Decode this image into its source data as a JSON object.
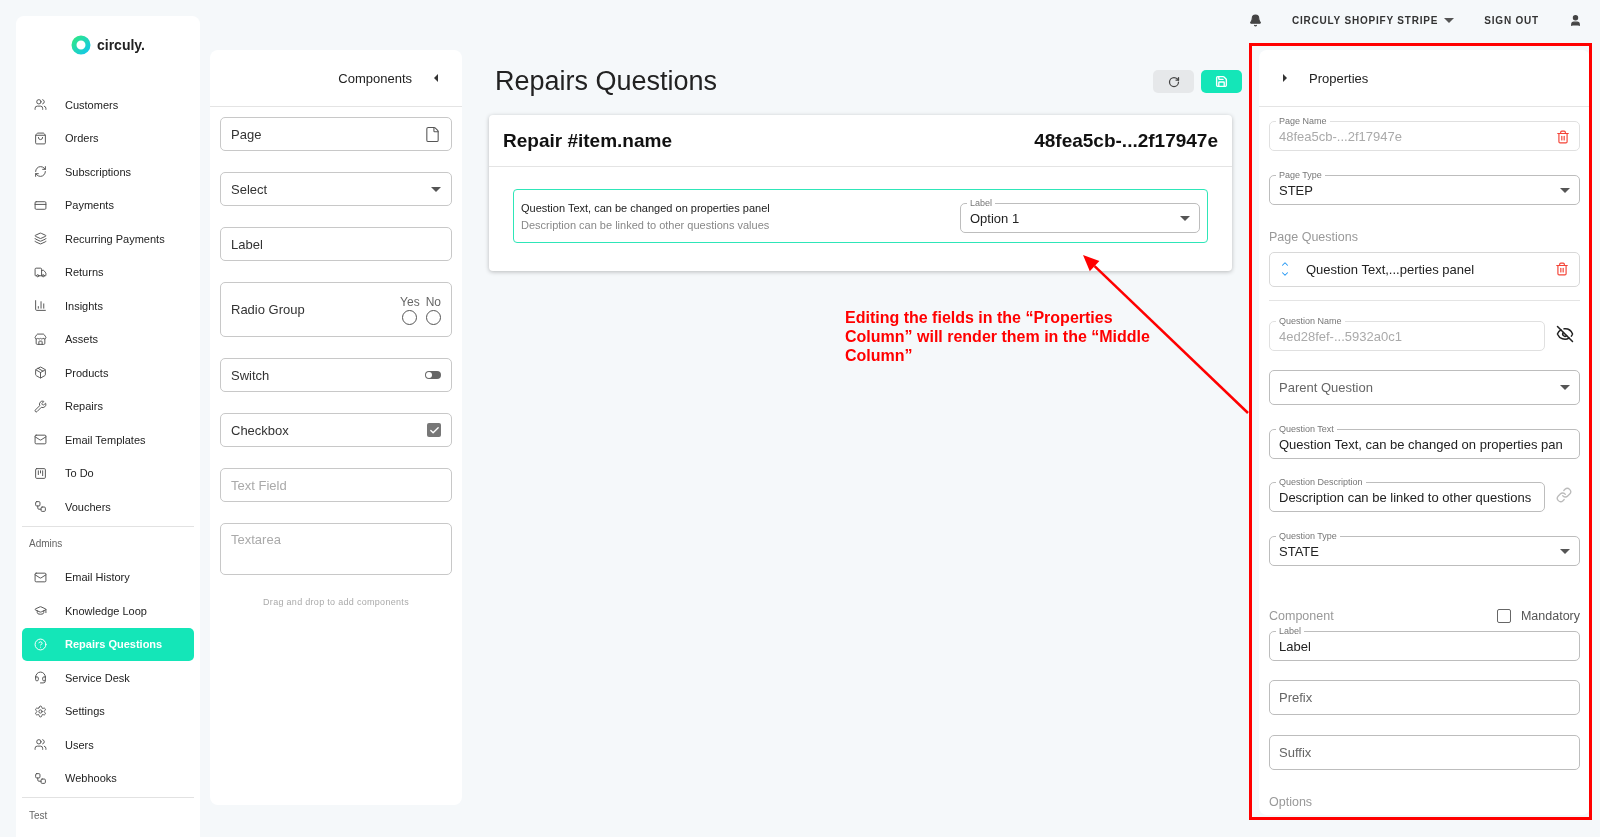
{
  "sidebar": {
    "logo": "circuly.",
    "groups": [
      {
        "items": [
          {
            "label": "Customers",
            "selected": false
          },
          {
            "label": "Orders",
            "selected": false
          },
          {
            "label": "Subscriptions",
            "selected": false
          },
          {
            "label": "Payments",
            "selected": false
          },
          {
            "label": "Recurring Payments",
            "selected": false
          },
          {
            "label": "Returns",
            "selected": false
          },
          {
            "label": "Insights",
            "selected": false
          },
          {
            "label": "Assets",
            "selected": false
          },
          {
            "label": "Products",
            "selected": false
          },
          {
            "label": "Repairs",
            "selected": false
          },
          {
            "label": "Email Templates",
            "selected": false
          },
          {
            "label": "To Do",
            "selected": false
          },
          {
            "label": "Vouchers",
            "selected": false
          }
        ]
      },
      {
        "heading": "Admins",
        "items": [
          {
            "label": "Email History",
            "selected": false
          },
          {
            "label": "Knowledge Loop",
            "selected": false
          },
          {
            "label": "Repairs Questions",
            "selected": true
          },
          {
            "label": "Service Desk",
            "selected": false
          },
          {
            "label": "Settings",
            "selected": false
          },
          {
            "label": "Users",
            "selected": false
          },
          {
            "label": "Webhooks",
            "selected": false
          }
        ]
      },
      {
        "heading": "Test"
      }
    ]
  },
  "top_bar": {
    "account": "CIRCULY SHOPIFY STRIPE",
    "sign_out": "SIGN OUT"
  },
  "components": {
    "title": "Components",
    "items": [
      {
        "kind": "page",
        "label": "Page"
      },
      {
        "kind": "select",
        "label": "Select"
      },
      {
        "kind": "label",
        "label": "Label"
      },
      {
        "kind": "radio",
        "label": "Radio Group",
        "options": [
          "Yes",
          "No"
        ]
      },
      {
        "kind": "switch",
        "label": "Switch",
        "on": false
      },
      {
        "kind": "checkbox",
        "label": "Checkbox",
        "checked": true
      },
      {
        "kind": "textfield",
        "placeholder": "Text Field"
      },
      {
        "kind": "textarea",
        "placeholder": "Textarea"
      }
    ],
    "hint": "Drag and drop to add components"
  },
  "main": {
    "title": "Repairs Questions",
    "card": {
      "title": "Repair #item.name",
      "id": "48fea5cb-...2f17947e",
      "question": {
        "text": "Question Text, can be changed on properties panel",
        "description": "Description can be linked to other questions values",
        "select": {
          "label": "Label",
          "value": "Option 1"
        }
      }
    },
    "annotation": "Editing the fields in the “Properties Column” will render them in the “Middle Column”"
  },
  "properties": {
    "title": "Properties",
    "items": [
      {
        "kind": "delete_field",
        "label": "Page Name",
        "value": "48fea5cb-...2f17947e",
        "disabled": true
      },
      {
        "kind": "select",
        "label": "Page Type",
        "value": "STEP"
      },
      {
        "kind": "section",
        "title": "Page Questions"
      },
      {
        "kind": "reorder_item",
        "value": "Question Text,...perties panel"
      },
      {
        "kind": "hide_field",
        "label": "Question Name",
        "value": "4ed28fef-...5932a0c1",
        "disabled": true
      },
      {
        "kind": "select",
        "placeholder": "Parent Question"
      },
      {
        "kind": "field",
        "label": "Question Text",
        "value": "Question Text, can be changed on properties pan",
        "disabled": false
      },
      {
        "kind": "link_field",
        "label": "Question Description",
        "value": "Description can be linked to other questions",
        "disabled": false
      },
      {
        "kind": "select",
        "label": "Question Type",
        "value": "STATE"
      },
      {
        "kind": "component_header",
        "title": "Component",
        "checkbox": {
          "label": "Mandatory",
          "checked": false
        }
      },
      {
        "kind": "field",
        "label": "Label",
        "value": "Label",
        "disabled": false
      },
      {
        "kind": "field",
        "placeholder": "Prefix"
      },
      {
        "kind": "field",
        "placeholder": "Suffix"
      },
      {
        "kind": "section",
        "title": "Options"
      }
    ]
  }
}
